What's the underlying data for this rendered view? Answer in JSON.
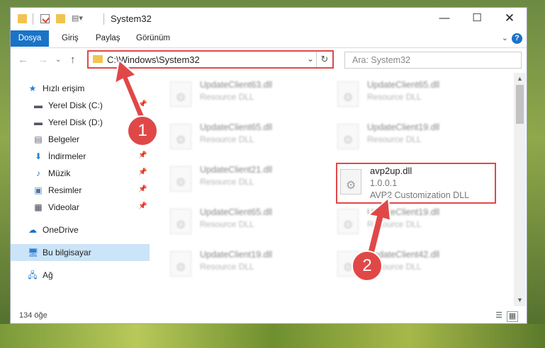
{
  "window": {
    "title": "System32"
  },
  "titlebar": {
    "controls": [
      "minimize-icon",
      "maximize-icon",
      "close-icon"
    ]
  },
  "ribbon": {
    "tabs": [
      "Dosya",
      "Giriş",
      "Paylaş",
      "Görünüm"
    ],
    "file_tab_color": "#1a73c7"
  },
  "address": {
    "path": "C:\\Windows\\System32"
  },
  "search": {
    "placeholder": "Ara: System32"
  },
  "nav": {
    "quick_access": "Hızlı erişim",
    "items": [
      {
        "label": "Yerel Disk (C:)",
        "icon": "drive-icon",
        "pinned": true
      },
      {
        "label": "Yerel Disk (D:)",
        "icon": "drive-icon",
        "pinned": false
      },
      {
        "label": "Belgeler",
        "icon": "documents-icon",
        "pinned": true
      },
      {
        "label": "İndirmeler",
        "icon": "downloads-icon",
        "pinned": true
      },
      {
        "label": "Müzik",
        "icon": "music-icon",
        "pinned": true
      },
      {
        "label": "Resimler",
        "icon": "pictures-icon",
        "pinned": true
      },
      {
        "label": "Videolar",
        "icon": "videos-icon",
        "pinned": true
      }
    ],
    "onedrive": "OneDrive",
    "this_pc": "Bu bilgisayar",
    "network": "Ağ"
  },
  "files": [
    {
      "name": "UpdateClient63.dll",
      "desc": "Resource DLL"
    },
    {
      "name": "UpdateClient65.dll",
      "desc": "Resource DLL"
    },
    {
      "name": "UpdateClient65.dll",
      "desc": "Resource DLL"
    },
    {
      "name": "UpdateClient19.dll",
      "desc": "Resource DLL"
    },
    {
      "name": "UpdateClient21.dll",
      "desc": "Resource DLL"
    },
    {
      "name": "avp2up.dll",
      "version": "1.0.0.1",
      "desc": "AVP2 Customization DLL"
    },
    {
      "name": "UpdateClient65.dll",
      "desc": "Resource DLL"
    },
    {
      "name": "UpdateClient19.dll",
      "desc": "Resource DLL"
    },
    {
      "name": "UpdateClient19.dll",
      "desc": "Resource DLL"
    },
    {
      "name": "UpdateClient42.dll",
      "desc": "Resource DLL"
    }
  ],
  "status": {
    "count": "134 öğe"
  },
  "callouts": {
    "step1": "1",
    "step2": "2",
    "color": "#e04848"
  }
}
